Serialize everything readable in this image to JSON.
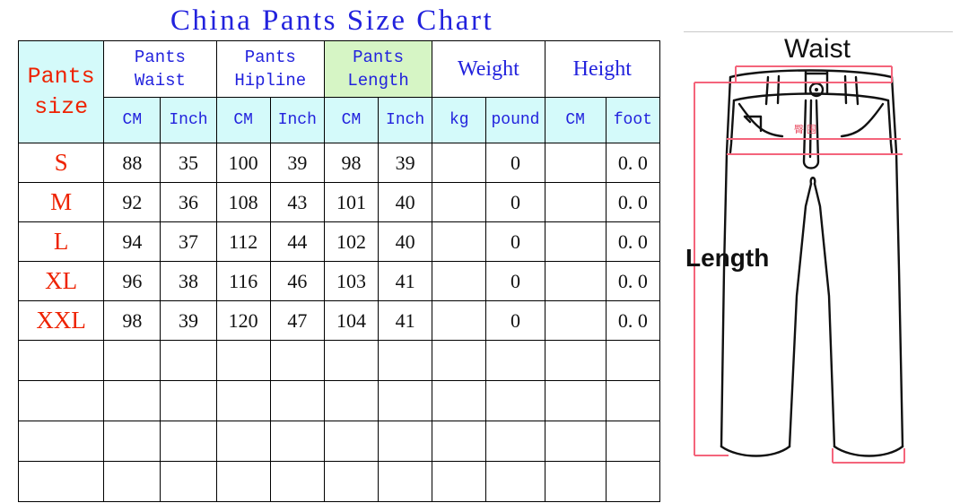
{
  "title": "China Pants Size Chart",
  "table": {
    "size_header": {
      "line1": "Pants",
      "line2": "size"
    },
    "groups": [
      {
        "line1": "Pants",
        "line2": "Waist",
        "highlight": false
      },
      {
        "line1": "Pants",
        "line2": "Hipline",
        "highlight": false
      },
      {
        "line1": "Pants",
        "line2": "Length",
        "highlight": true
      },
      {
        "line1": "Weight",
        "line2": "",
        "highlight": false
      },
      {
        "line1": "Height",
        "line2": "",
        "highlight": false
      }
    ],
    "units": [
      "CM",
      "Inch",
      "CM",
      "Inch",
      "CM",
      "Inch",
      "kg",
      "pound",
      "CM",
      "foot"
    ],
    "rows": [
      {
        "size": "S",
        "values": [
          "88",
          "35",
          "100",
          "39",
          "98",
          "39",
          "",
          "0",
          "",
          "0. 0"
        ]
      },
      {
        "size": "M",
        "values": [
          "92",
          "36",
          "108",
          "43",
          "101",
          "40",
          "",
          "0",
          "",
          "0. 0"
        ]
      },
      {
        "size": "L",
        "values": [
          "94",
          "37",
          "112",
          "44",
          "102",
          "40",
          "",
          "0",
          "",
          "0. 0"
        ]
      },
      {
        "size": "XL",
        "values": [
          "96",
          "38",
          "116",
          "46",
          "103",
          "41",
          "",
          "0",
          "",
          "0. 0"
        ]
      },
      {
        "size": "XXL",
        "values": [
          "98",
          "39",
          "120",
          "47",
          "104",
          "41",
          "",
          "0",
          "",
          "0. 0"
        ]
      }
    ],
    "blank_row_count": 4
  },
  "figure": {
    "waist_label": "Waist",
    "length_label": "Length",
    "hipline_cn": "臀围"
  },
  "colors": {
    "title_blue": "#2222dd",
    "size_red": "#ee2200",
    "header_cyan": "#d4fafa",
    "highlight_green": "#d6f5c5",
    "measure_red": "#f4647b",
    "outline_black": "#111111"
  }
}
